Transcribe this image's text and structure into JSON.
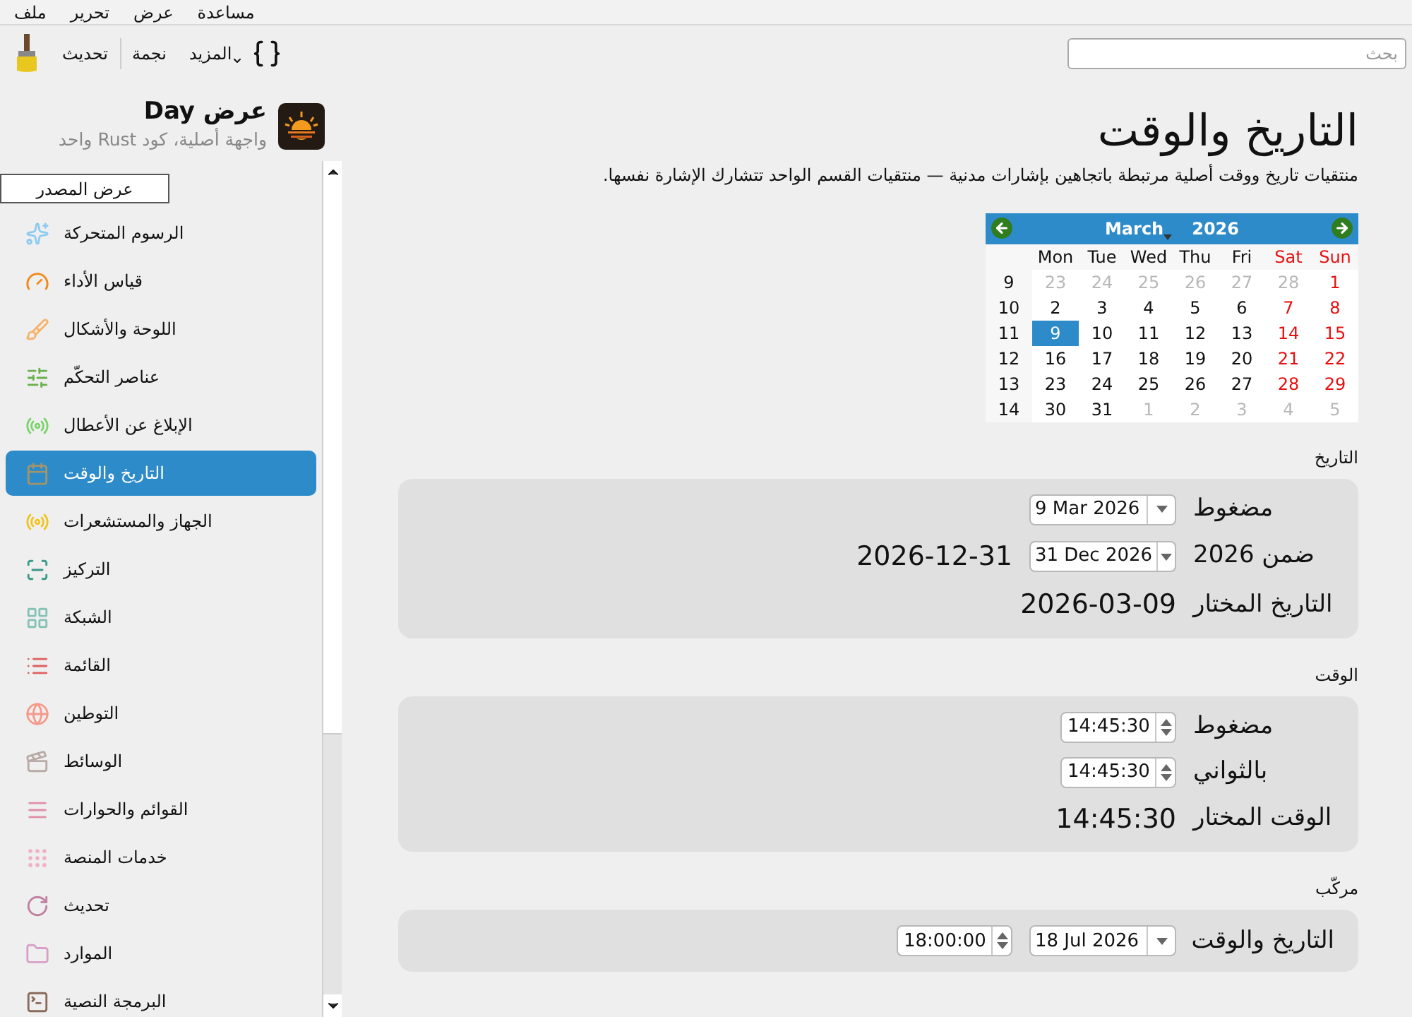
{
  "menu_bar": [
    "مساعدة",
    "عرض",
    "تحرير",
    "ملف"
  ],
  "toolbar": {
    "buttons": [
      {
        "label": "المزيد",
        "kind": "menu"
      },
      {
        "label": "نجمة",
        "kind": "plain"
      },
      {
        "label": "تحديث",
        "kind": "plain"
      }
    ],
    "search": {
      "placeholder": "بحث"
    }
  },
  "sidebar": {
    "title": "عرض Day",
    "subtitle": "واجهة أصلية، كود Rust واحد",
    "tooltip": "عرض المصدر",
    "items": [
      {
        "label": "الرسوم المتحركة",
        "selected": false
      },
      {
        "label": "قياس الأداء",
        "selected": false
      },
      {
        "label": "اللوحة والأشكال",
        "selected": false
      },
      {
        "label": "عناصر التحكّم",
        "selected": false
      },
      {
        "label": "الإبلاغ عن الأعطال",
        "selected": false
      },
      {
        "label": "التاريخ والوقت",
        "selected": true
      },
      {
        "label": "الجهاز والمستشعرات",
        "selected": false
      },
      {
        "label": "التركيز",
        "selected": false
      },
      {
        "label": "الشبكة",
        "selected": false
      },
      {
        "label": "القائمة",
        "selected": false
      },
      {
        "label": "التوطين",
        "selected": false
      },
      {
        "label": "الوسائط",
        "selected": false
      },
      {
        "label": "القوائم والحوارات",
        "selected": false
      },
      {
        "label": "خدمات المنصة",
        "selected": false
      },
      {
        "label": "تحديث",
        "selected": false
      },
      {
        "label": "الموارد",
        "selected": false
      },
      {
        "label": "البرمجة النصية",
        "selected": false
      }
    ]
  },
  "page": {
    "title": "التاريخ والوقت",
    "description": "منتقيات تاريخ ووقت أصلية مرتبطة باتجاهين بإشارات مدنية — منتقيات القسم الواحد تتشارك الإشارة نفسها."
  },
  "calendar": {
    "month": "March",
    "year": "2026",
    "weekdays": [
      {
        "label": "Sun",
        "weekend": true
      },
      {
        "label": "Sat",
        "weekend": true
      },
      {
        "label": "Fri",
        "weekend": false
      },
      {
        "label": "Thu",
        "weekend": false
      },
      {
        "label": "Wed",
        "weekend": false
      },
      {
        "label": "Tue",
        "weekend": false
      },
      {
        "label": "Mon",
        "weekend": false
      }
    ],
    "weeks": [
      {
        "number": "9",
        "days": [
          {
            "d": "1",
            "outside": false,
            "selected": false
          },
          {
            "d": "28",
            "outside": true,
            "selected": false
          },
          {
            "d": "27",
            "outside": true,
            "selected": false
          },
          {
            "d": "26",
            "outside": true,
            "selected": false
          },
          {
            "d": "25",
            "outside": true,
            "selected": false
          },
          {
            "d": "24",
            "outside": true,
            "selected": false
          },
          {
            "d": "23",
            "outside": true,
            "selected": false
          }
        ]
      },
      {
        "number": "10",
        "days": [
          {
            "d": "8",
            "outside": false,
            "selected": false
          },
          {
            "d": "7",
            "outside": false,
            "selected": false
          },
          {
            "d": "6",
            "outside": false,
            "selected": false
          },
          {
            "d": "5",
            "outside": false,
            "selected": false
          },
          {
            "d": "4",
            "outside": false,
            "selected": false
          },
          {
            "d": "3",
            "outside": false,
            "selected": false
          },
          {
            "d": "2",
            "outside": false,
            "selected": false
          }
        ]
      },
      {
        "number": "11",
        "days": [
          {
            "d": "15",
            "outside": false,
            "selected": false
          },
          {
            "d": "14",
            "outside": false,
            "selected": false
          },
          {
            "d": "13",
            "outside": false,
            "selected": false
          },
          {
            "d": "12",
            "outside": false,
            "selected": false
          },
          {
            "d": "11",
            "outside": false,
            "selected": false
          },
          {
            "d": "10",
            "outside": false,
            "selected": false
          },
          {
            "d": "9",
            "outside": false,
            "selected": true
          }
        ]
      },
      {
        "number": "12",
        "days": [
          {
            "d": "22",
            "outside": false,
            "selected": false
          },
          {
            "d": "21",
            "outside": false,
            "selected": false
          },
          {
            "d": "20",
            "outside": false,
            "selected": false
          },
          {
            "d": "19",
            "outside": false,
            "selected": false
          },
          {
            "d": "18",
            "outside": false,
            "selected": false
          },
          {
            "d": "17",
            "outside": false,
            "selected": false
          },
          {
            "d": "16",
            "outside": false,
            "selected": false
          }
        ]
      },
      {
        "number": "13",
        "days": [
          {
            "d": "29",
            "outside": false,
            "selected": false
          },
          {
            "d": "28",
            "outside": false,
            "selected": false
          },
          {
            "d": "27",
            "outside": false,
            "selected": false
          },
          {
            "d": "26",
            "outside": false,
            "selected": false
          },
          {
            "d": "25",
            "outside": false,
            "selected": false
          },
          {
            "d": "24",
            "outside": false,
            "selected": false
          },
          {
            "d": "23",
            "outside": false,
            "selected": false
          }
        ]
      },
      {
        "number": "14",
        "days": [
          {
            "d": "5",
            "outside": true,
            "selected": false
          },
          {
            "d": "4",
            "outside": true,
            "selected": false
          },
          {
            "d": "3",
            "outside": true,
            "selected": false
          },
          {
            "d": "2",
            "outside": true,
            "selected": false
          },
          {
            "d": "1",
            "outside": true,
            "selected": false
          },
          {
            "d": "31",
            "outside": false,
            "selected": false
          },
          {
            "d": "30",
            "outside": false,
            "selected": false
          }
        ]
      }
    ]
  },
  "sections": [
    {
      "heading": "التاريخ",
      "rows": [
        {
          "label": "مضغوط",
          "controls": [
            {
              "kind": "date",
              "value": "9 Mar 2026"
            }
          ]
        },
        {
          "label": "ضمن 2026",
          "controls": [
            {
              "kind": "date",
              "value": "31 Dec 2026"
            },
            {
              "kind": "text",
              "value": "2026-12-31"
            }
          ]
        },
        {
          "label": "التاريخ المختار",
          "controls": [
            {
              "kind": "text",
              "value": "2026-03-09"
            }
          ]
        }
      ]
    },
    {
      "heading": "الوقت",
      "rows": [
        {
          "label": "مضغوط",
          "controls": [
            {
              "kind": "time",
              "value": "14:45:30"
            }
          ]
        },
        {
          "label": "بالثواني",
          "controls": [
            {
              "kind": "time",
              "value": "14:45:30"
            }
          ]
        },
        {
          "label": "الوقت المختار",
          "controls": [
            {
              "kind": "text",
              "value": "14:45:30"
            }
          ]
        }
      ]
    },
    {
      "heading": "مركّب",
      "rows": [
        {
          "label": "التاريخ والوقت",
          "controls": [
            {
              "kind": "date",
              "value": "18 Jul 2026"
            },
            {
              "kind": "time",
              "value": "18:00:00"
            }
          ]
        }
      ]
    }
  ]
}
